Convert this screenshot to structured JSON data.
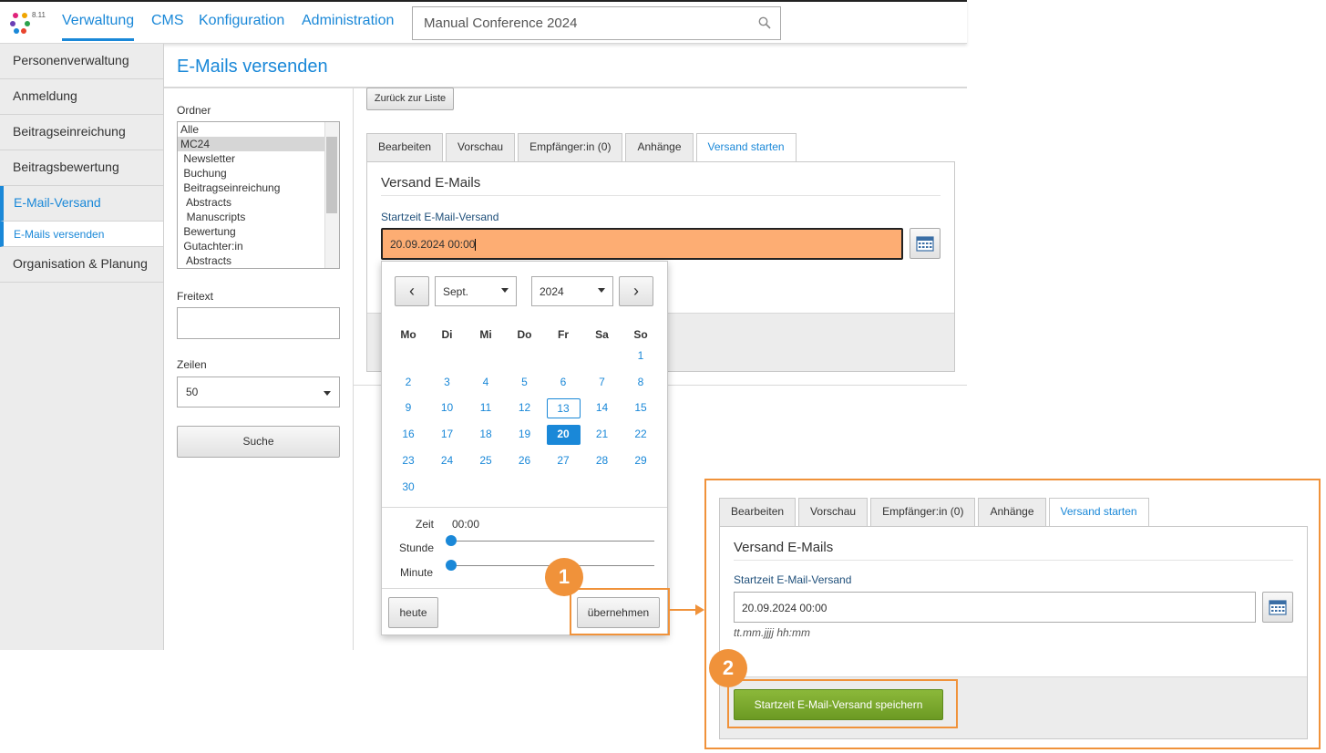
{
  "app": {
    "version": "8.11",
    "nav": [
      "Verwaltung",
      "CMS",
      "Konfiguration",
      "Administration"
    ],
    "search_value": "Manual Conference 2024"
  },
  "sidebar": {
    "items": [
      {
        "label": "Personenverwaltung"
      },
      {
        "label": "Anmeldung"
      },
      {
        "label": "Beitragseinreichung"
      },
      {
        "label": "Beitragsbewertung"
      },
      {
        "label": "E-Mail-Versand"
      },
      {
        "label": "Organisation & Planung"
      }
    ],
    "sub_active": "E-Mails versenden"
  },
  "page": {
    "title": "E-Mails versenden"
  },
  "filters": {
    "ordner_label": "Ordner",
    "ordner_options": [
      "Alle",
      "MC24",
      " Newsletter",
      " Buchung",
      " Beitragseinreichung",
      "  Abstracts",
      "  Manuscripts",
      " Bewertung",
      " Gutachter:in",
      "  Abstracts"
    ],
    "ordner_selected": "MC24",
    "freitext_label": "Freitext",
    "freitext_value": "",
    "zeilen_label": "Zeilen",
    "zeilen_value": "50",
    "search_button": "Suche"
  },
  "main": {
    "back_button": "Zurück zur Liste",
    "tabs": [
      "Bearbeiten",
      "Vorschau",
      "Empfänger:in (0)",
      "Anhänge",
      "Versand starten"
    ],
    "active_tab": "Versand starten",
    "section_title": "Versand E-Mails",
    "field_label": "Startzeit E-Mail-Versand",
    "field_value": "20.09.2024 00:00"
  },
  "datepicker": {
    "month": "Sept.",
    "year": "2024",
    "weekdays": [
      "Mo",
      "Di",
      "Mi",
      "Do",
      "Fr",
      "Sa",
      "So"
    ],
    "days": [
      1,
      2,
      3,
      4,
      5,
      6,
      7,
      8,
      9,
      10,
      11,
      12,
      13,
      14,
      15,
      16,
      17,
      18,
      19,
      20,
      21,
      22,
      23,
      24,
      25,
      26,
      27,
      28,
      29,
      30
    ],
    "first_weekday_index": 6,
    "today": 13,
    "selected": 20,
    "time_label": "Zeit",
    "time_value": "00:00",
    "hour_label": "Stunde",
    "minute_label": "Minute",
    "hour_value": 0,
    "minute_value": 0,
    "today_button": "heute",
    "apply_button": "übernehmen"
  },
  "callouts": {
    "badge1": "1",
    "badge2": "2",
    "accent": "#f0923a"
  },
  "zoom": {
    "tabs": [
      "Bearbeiten",
      "Vorschau",
      "Empfänger:in (0)",
      "Anhänge",
      "Versand starten"
    ],
    "section_title": "Versand E-Mails",
    "field_label": "Startzeit E-Mail-Versand",
    "field_value": "20.09.2024 00:00",
    "format_hint": "tt.mm.jjjj hh:mm",
    "save_button": "Startzeit E-Mail-Versand speichern"
  }
}
